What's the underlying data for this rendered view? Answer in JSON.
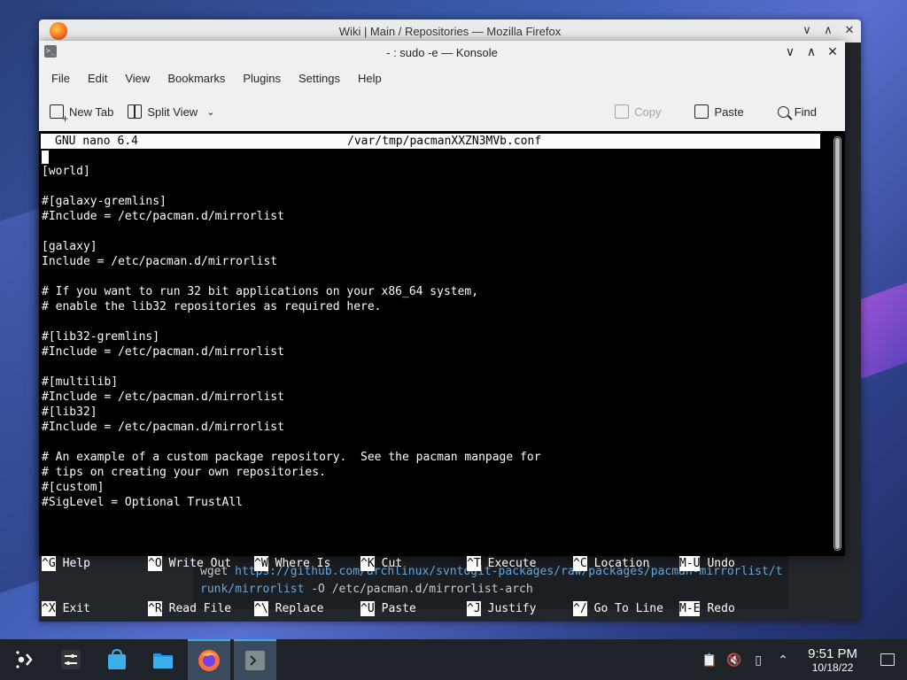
{
  "firefox": {
    "title": "Wiki | Main / Repositories — Mozilla Firefox",
    "controls": [
      "∨",
      "∧",
      "✕"
    ],
    "code_block": {
      "line1_prefix": "wget ",
      "line1_url": "https://github.com/archlinux/svntogit-packages/raw/packages/pacman-mirrorlist/t",
      "line2_url": "runk/mirrorlist",
      "line2_rest": " -O /etc/pacman.d/mirrorlist-arch"
    }
  },
  "konsole": {
    "title": "- : sudo -e — Konsole",
    "controls": [
      "∨",
      "∧",
      "✕"
    ],
    "menu": [
      "File",
      "Edit",
      "View",
      "Bookmarks",
      "Plugins",
      "Settings",
      "Help"
    ],
    "toolbar": {
      "new_tab": "New Tab",
      "split_view": "Split View",
      "copy": "Copy",
      "paste": "Paste",
      "find": "Find"
    }
  },
  "nano": {
    "version": "GNU nano 6.4",
    "filename": "/var/tmp/pacmanXXZN3MVb.conf",
    "lines": [
      "[world]",
      "",
      "#[galaxy-gremlins]",
      "#Include = /etc/pacman.d/mirrorlist",
      "",
      "[galaxy]",
      "Include = /etc/pacman.d/mirrorlist",
      "",
      "# If you want to run 32 bit applications on your x86_64 system,",
      "# enable the lib32 repositories as required here.",
      "",
      "#[lib32-gremlins]",
      "#Include = /etc/pacman.d/mirrorlist",
      "",
      "#[multilib]",
      "#Include = /etc/pacman.d/mirrorlist",
      "#[lib32]",
      "#Include = /etc/pacman.d/mirrorlist",
      "",
      "# An example of a custom package repository.  See the pacman manpage for",
      "# tips on creating your own repositories.",
      "#[custom]",
      "#SigLevel = Optional TrustAll"
    ],
    "shortcuts_row1": [
      {
        "key": "^G",
        "label": "Help"
      },
      {
        "key": "^O",
        "label": "Write Out"
      },
      {
        "key": "^W",
        "label": "Where Is"
      },
      {
        "key": "^K",
        "label": "Cut"
      },
      {
        "key": "^T",
        "label": "Execute"
      },
      {
        "key": "^C",
        "label": "Location"
      },
      {
        "key": "M-U",
        "label": "Undo"
      }
    ],
    "shortcuts_row2": [
      {
        "key": "^X",
        "label": "Exit"
      },
      {
        "key": "^R",
        "label": "Read File"
      },
      {
        "key": "^\\",
        "label": "Replace"
      },
      {
        "key": "^U",
        "label": "Paste"
      },
      {
        "key": "^J",
        "label": "Justify"
      },
      {
        "key": "^/",
        "label": "Go To Line"
      },
      {
        "key": "M-E",
        "label": "Redo"
      }
    ]
  },
  "taskbar": {
    "apps": [
      "application-launcher-icon",
      "settings-icon",
      "discover-store-icon",
      "file-manager-icon",
      "firefox-icon",
      "konsole-icon"
    ],
    "time": "9:51 PM",
    "date": "10/18/22"
  },
  "colors": {
    "terminal_bg": "#000000",
    "terminal_fg": "#fcfcfc",
    "taskbar_bg": "#1e2229",
    "accent": "#3daee9"
  }
}
